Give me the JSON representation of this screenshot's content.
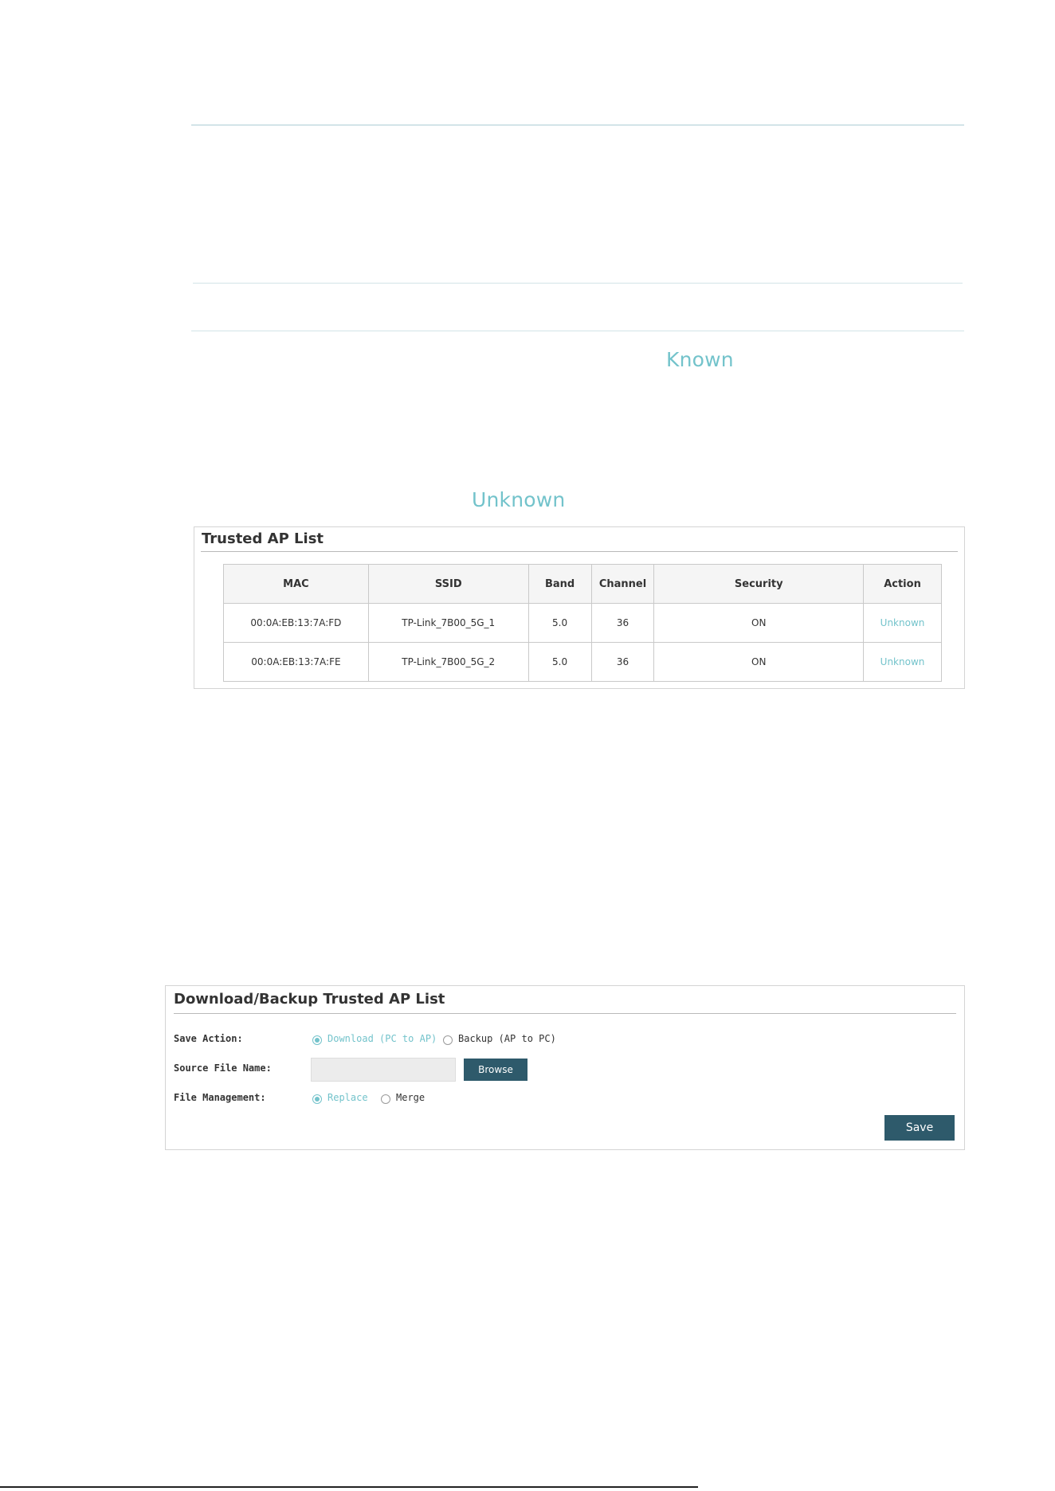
{
  "links": {
    "known": "Known",
    "unknown": "Unknown"
  },
  "trusted_panel": {
    "title": "Trusted AP List",
    "columns": [
      "MAC",
      "SSID",
      "Band",
      "Channel",
      "Security",
      "Action"
    ],
    "rows": [
      {
        "mac": "00:0A:EB:13:7A:FD",
        "ssid": "TP-Link_7B00_5G_1",
        "band": "5.0",
        "channel": "36",
        "security": "ON",
        "action": "Unknown"
      },
      {
        "mac": "00:0A:EB:13:7A:FE",
        "ssid": "TP-Link_7B00_5G_2",
        "band": "5.0",
        "channel": "36",
        "security": "ON",
        "action": "Unknown"
      }
    ]
  },
  "backup_panel": {
    "title": "Download/Backup Trusted AP List",
    "save_action_label": "Save Action:",
    "save_action_options": [
      "Download (PC to AP)",
      "Backup (AP to PC)"
    ],
    "save_action_selected": "Download (PC to AP)",
    "source_file_label": "Source File Name:",
    "source_file_value": "",
    "browse_label": "Browse",
    "file_mgmt_label": "File Management:",
    "file_mgmt_options": [
      "Replace",
      "Merge"
    ],
    "file_mgmt_selected": "Replace",
    "save_label": "Save"
  },
  "colors": {
    "accent": "#73c3cb",
    "button": "#2e5a6b"
  }
}
